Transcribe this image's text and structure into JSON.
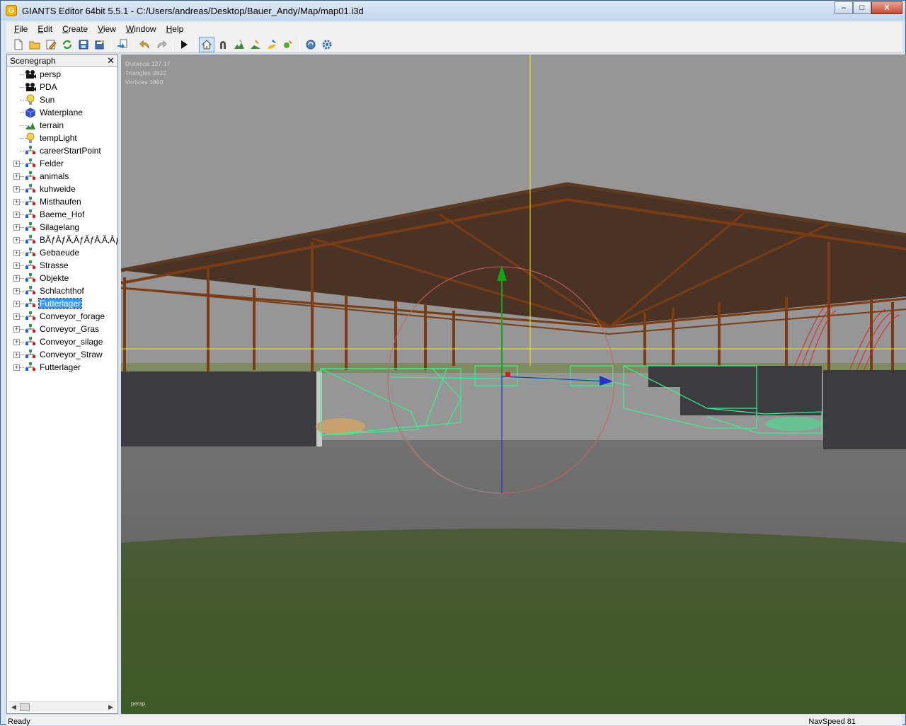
{
  "window": {
    "title": "GIANTS Editor 64bit 5.5.1 - C:/Users/andreas/Desktop/Bauer_Andy/Map/map01.i3d",
    "app_icon": "G",
    "minimize": "–",
    "maximize": "□",
    "close": "X"
  },
  "menu": [
    {
      "label": "File"
    },
    {
      "label": "Edit"
    },
    {
      "label": "Create"
    },
    {
      "label": "View"
    },
    {
      "label": "Window"
    },
    {
      "label": "Help"
    }
  ],
  "toolbar": {
    "icons": [
      "new-file-icon",
      "open-file-icon",
      "edit-file-icon",
      "reload-icon",
      "save-icon",
      "save-as-icon",
      "import-icon",
      "undo-icon",
      "redo-icon",
      "play-icon",
      "select-tool-icon",
      "magnet-icon",
      "terrain-sculpt-icon",
      "terrain-paint-icon",
      "foliage-paint-icon",
      "plant-paint-icon",
      "refresh-shaders-icon",
      "settings-icon"
    ]
  },
  "scenegraph": {
    "title": "Scenegraph",
    "close": "✕",
    "items": [
      {
        "label": "persp",
        "icon": "camera-icon",
        "expandable": false,
        "selected": false
      },
      {
        "label": "PDA",
        "icon": "camera-icon",
        "expandable": false,
        "selected": false
      },
      {
        "label": "Sun",
        "icon": "light-icon",
        "expandable": false,
        "selected": false
      },
      {
        "label": "Waterplane",
        "icon": "shape-icon",
        "expandable": false,
        "selected": false
      },
      {
        "label": "terrain",
        "icon": "terrain-icon",
        "expandable": false,
        "selected": false
      },
      {
        "label": "tempLight",
        "icon": "light-icon",
        "expandable": false,
        "selected": false
      },
      {
        "label": "careerStartPoint",
        "icon": "transform-group-icon",
        "expandable": false,
        "selected": false
      },
      {
        "label": "Felder",
        "icon": "transform-group-icon",
        "expandable": true,
        "selected": false
      },
      {
        "label": "animals",
        "icon": "transform-group-icon",
        "expandable": true,
        "selected": false
      },
      {
        "label": "kuhweide",
        "icon": "transform-group-icon",
        "expandable": true,
        "selected": false
      },
      {
        "label": "Misthaufen",
        "icon": "transform-group-icon",
        "expandable": true,
        "selected": false
      },
      {
        "label": "Baeme_Hof",
        "icon": "transform-group-icon",
        "expandable": true,
        "selected": false
      },
      {
        "label": "Silagelang",
        "icon": "transform-group-icon",
        "expandable": true,
        "selected": false
      },
      {
        "label": "BÃƒÂƒÃ‚ÂƒÃƒÂ‚Ã‚Âƒ",
        "icon": "transform-group-icon",
        "expandable": true,
        "selected": false
      },
      {
        "label": "Gebaeude",
        "icon": "transform-group-icon",
        "expandable": true,
        "selected": false
      },
      {
        "label": "Strasse",
        "icon": "transform-group-icon",
        "expandable": true,
        "selected": false
      },
      {
        "label": "Objekte",
        "icon": "transform-group-icon",
        "expandable": true,
        "selected": false
      },
      {
        "label": "Schlachthof",
        "icon": "transform-group-icon",
        "expandable": true,
        "selected": false
      },
      {
        "label": "Futterlager",
        "icon": "transform-group-icon",
        "expandable": true,
        "selected": true
      },
      {
        "label": "Conveyor_forage",
        "icon": "transform-group-icon",
        "expandable": true,
        "selected": false
      },
      {
        "label": "Conveyor_Gras",
        "icon": "transform-group-icon",
        "expandable": true,
        "selected": false
      },
      {
        "label": "Conveyor_silage",
        "icon": "transform-group-icon",
        "expandable": true,
        "selected": false
      },
      {
        "label": "Conveyor_Straw",
        "icon": "transform-group-icon",
        "expandable": true,
        "selected": false
      },
      {
        "label": "Futterlager",
        "icon": "transform-group-icon",
        "expandable": true,
        "selected": false
      }
    ]
  },
  "viewport": {
    "stats": [
      "Distance 127.17",
      "Triangles 2832",
      "Vertices 1860"
    ],
    "camera_label": "persp",
    "colors": {
      "sky": "#969696",
      "roof": "#4a3325",
      "beam": "#7a3c12",
      "wall": "#3c3c40",
      "floor": "#6d6d6d",
      "grass": "#46592f",
      "selection": "#3af08f",
      "axis_y": "#18a418",
      "axis_z": "#2430d0",
      "axis_x": "#d02020",
      "horizon_line": "#f0f000"
    }
  },
  "status": {
    "left": "Ready",
    "right": "NavSpeed 81"
  }
}
